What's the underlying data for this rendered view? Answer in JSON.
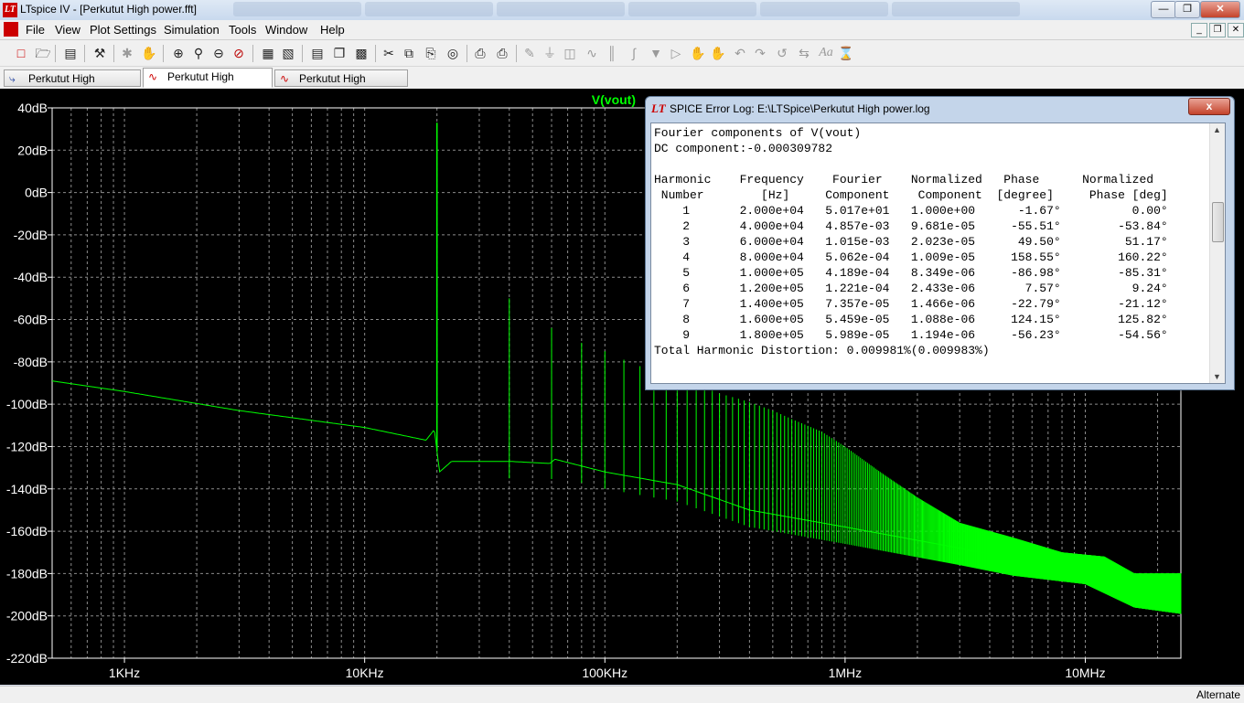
{
  "window": {
    "title": "LTspice IV - [Perkutut High power.fft]",
    "icon_glyph": "LT"
  },
  "menu": {
    "items": [
      "File",
      "View",
      "Plot Settings",
      "Simulation",
      "Tools",
      "Window",
      "Help"
    ]
  },
  "toolbar": {
    "icons": [
      "new-schematic-icon",
      "open-icon",
      "save-icon",
      "hammer-icon",
      "run-icon",
      "halt-icon",
      "zoom-in-icon",
      "zoom-area-icon",
      "zoom-out-icon",
      "zoom-cancel-icon",
      "autorange-icon",
      "fft-icon",
      "tile-icon",
      "cascade-icon",
      "close-all-icon",
      "cut-icon",
      "copy-icon",
      "paste-icon",
      "find-icon",
      "print-setup-icon",
      "print-icon",
      "wire-icon",
      "ground-icon",
      "label-icon",
      "resistor-icon",
      "capacitor-icon",
      "inductor-icon",
      "diode-icon",
      "component-icon",
      "move-icon",
      "drag-icon",
      "undo-icon",
      "redo-icon",
      "rotate-icon",
      "mirror-icon",
      "text-icon",
      "spice-directive-icon"
    ]
  },
  "tabs": [
    {
      "label": "Perkutut High power.asc",
      "icon": "schematic-icon",
      "active": false
    },
    {
      "label": "Perkutut High power.fft",
      "icon": "waveform-icon",
      "active": true
    },
    {
      "label": "Perkutut High power.raw",
      "icon": "waveform-icon",
      "active": false
    }
  ],
  "status": {
    "mode": "Alternate"
  },
  "log_window": {
    "title": "SPICE Error Log: E:\\LTSpice\\Perkutut High power.log",
    "close_label": "x",
    "heading": "Fourier components of V(vout)",
    "dc": "DC component:-0.000309782",
    "header_line1": "Harmonic    Frequency    Fourier    Normalized   Phase      Normalized",
    "header_line2": " Number        [Hz]     Component    Component  [degree]     Phase [deg]",
    "rows": [
      "    1       2.000e+04   5.017e+01   1.000e+00      -1.67°          0.00°",
      "    2       4.000e+04   4.857e-03   9.681e-05     -55.51°        -53.84°",
      "    3       6.000e+04   1.015e-03   2.023e-05      49.50°         51.17°",
      "    4       8.000e+04   5.062e-04   1.009e-05     158.55°        160.22°",
      "    5       1.000e+05   4.189e-04   8.349e-06     -86.98°        -85.31°",
      "    6       1.200e+05   1.221e-04   2.433e-06       7.57°          9.24°",
      "    7       1.400e+05   7.357e-05   1.466e-06     -22.79°        -21.12°",
      "    8       1.600e+05   5.459e-05   1.088e-06     124.15°        125.82°",
      "    9       1.800e+05   5.989e-05   1.194e-06     -56.23°        -54.56°"
    ],
    "thd": "Total Harmonic Distortion: 0.009981%(0.009983%)"
  },
  "chart_data": {
    "type": "line",
    "trace_label": "V(vout)",
    "x_scale": "log",
    "y_unit": "dB",
    "xlim": [
      500,
      25000000
    ],
    "ylim": [
      -220,
      40
    ],
    "grid": true,
    "y_ticks": [
      {
        "value": 40,
        "label": "40dB"
      },
      {
        "value": 20,
        "label": "20dB"
      },
      {
        "value": 0,
        "label": "0dB"
      },
      {
        "value": -20,
        "label": "-20dB"
      },
      {
        "value": -40,
        "label": "-40dB"
      },
      {
        "value": -60,
        "label": "-60dB"
      },
      {
        "value": -80,
        "label": "-80dB"
      },
      {
        "value": -100,
        "label": "-100dB"
      },
      {
        "value": -120,
        "label": "-120dB"
      },
      {
        "value": -140,
        "label": "-140dB"
      },
      {
        "value": -160,
        "label": "-160dB"
      },
      {
        "value": -180,
        "label": "-180dB"
      },
      {
        "value": -200,
        "label": "-200dB"
      },
      {
        "value": -220,
        "label": "-220dB"
      }
    ],
    "x_ticks": [
      {
        "value": 1000,
        "label": "1KHz"
      },
      {
        "value": 10000,
        "label": "10KHz"
      },
      {
        "value": 100000,
        "label": "100KHz"
      },
      {
        "value": 1000000,
        "label": "1MHz"
      },
      {
        "value": 10000000,
        "label": "10MHz"
      }
    ],
    "colors": {
      "background": "#000000",
      "trace": "#00ff00",
      "grid": "#8c8c8c",
      "tick_text": "#ffffff",
      "trace_label": "#00ff00"
    },
    "floor_points": [
      [
        500,
        -89
      ],
      [
        1000,
        -94
      ],
      [
        3000,
        -103
      ],
      [
        10000,
        -111
      ],
      [
        18000,
        -117
      ],
      [
        19500,
        -112
      ],
      [
        20500,
        -132
      ],
      [
        23000,
        -127
      ],
      [
        40000,
        -127
      ],
      [
        59000,
        -128
      ],
      [
        62000,
        -126
      ],
      [
        100000,
        -132
      ],
      [
        200000,
        -138
      ],
      [
        400000,
        -150
      ],
      [
        1000000,
        -158
      ],
      [
        3000000,
        -168
      ],
      [
        5000000,
        -173
      ],
      [
        10000000,
        -177
      ],
      [
        16000000,
        -188
      ],
      [
        25000000,
        -191
      ]
    ],
    "fundamental": {
      "x": 20000,
      "y": 33
    },
    "harmonic_spur_tops": [
      [
        40000,
        -50
      ],
      [
        60000,
        -64
      ],
      [
        80000,
        -71
      ],
      [
        100000,
        -75
      ],
      [
        120000,
        -79
      ],
      [
        140000,
        -82
      ],
      [
        160000,
        -84
      ],
      [
        180000,
        -86
      ],
      [
        200000,
        -88
      ],
      [
        220000,
        -90
      ],
      [
        240000,
        -91
      ],
      [
        260000,
        -92
      ],
      [
        300000,
        -95
      ],
      [
        350000,
        -97
      ],
      [
        400000,
        -99
      ],
      [
        500000,
        -103
      ],
      [
        600000,
        -107
      ],
      [
        800000,
        -113
      ],
      [
        1000000,
        -120
      ],
      [
        1400000,
        -132
      ],
      [
        2000000,
        -144
      ],
      [
        3000000,
        -156
      ],
      [
        5000000,
        -163
      ],
      [
        8000000,
        -170
      ],
      [
        12000000,
        -172
      ],
      [
        16000000,
        -180
      ]
    ]
  }
}
